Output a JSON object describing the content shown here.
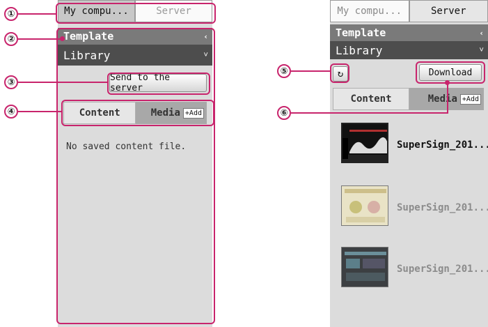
{
  "callouts": [
    "①",
    "②",
    "③",
    "④",
    "⑤",
    "⑥"
  ],
  "left": {
    "tabs": [
      "My compu...",
      "Server"
    ],
    "template_label": "Template",
    "library_label": "Library",
    "send_button": "Send to the server",
    "subtabs": {
      "content": "Content",
      "media": "Media",
      "add": "+Add"
    },
    "empty_message": "No saved content file."
  },
  "right": {
    "tabs": [
      "My compu...",
      "Server"
    ],
    "template_label": "Template",
    "library_label": "Library",
    "download_button": "Download",
    "refresh_icon": "refresh-icon",
    "subtabs": {
      "content": "Content",
      "media": "Media",
      "add": "+Add"
    },
    "items": [
      {
        "label": "SuperSign_201...",
        "selected": true
      },
      {
        "label": "SuperSign_201...",
        "selected": false
      },
      {
        "label": "SuperSign_201...",
        "selected": false
      }
    ]
  },
  "colors": {
    "accent": "#c8246c"
  }
}
